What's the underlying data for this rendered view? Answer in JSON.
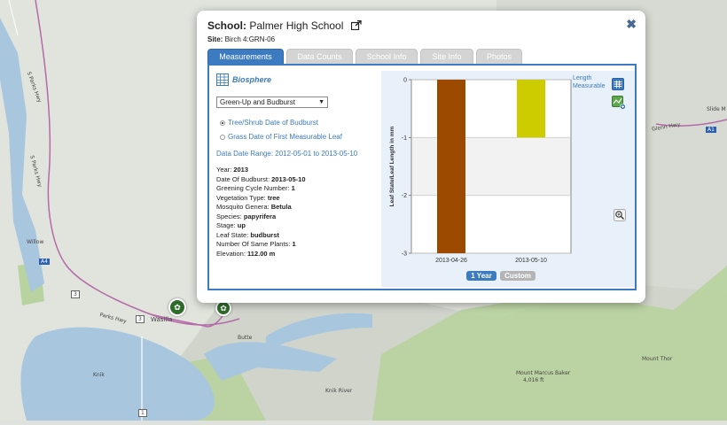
{
  "map": {
    "labels": {
      "parks_hwy_n": "S Parks Hwy",
      "parks_hwy_s": "S Parks Hwy",
      "willow": "Willow",
      "wasilla": "Wasilla",
      "parks_hwy_w": "Parks Hwy",
      "butte": "Butte",
      "knik": "Knik",
      "knik_river": "Knik River",
      "glenn_hwy": "Glenn Hwy",
      "slide_m": "Slide M",
      "mount_marcus_baker": "Mount Marcus Baker",
      "mount_marcus_baker_elev": "4,016 ft",
      "mount_thor": "Mount Thor",
      "shield_3": "3",
      "shield_3b": "3",
      "shield_a4": "A4",
      "shield_a1": "A1",
      "shield_1": "1"
    }
  },
  "popup": {
    "school_label": "School:",
    "school_name": "Palmer High School",
    "site_label": "Site:",
    "site_value": "Birch 4:GRN-06",
    "tabs": [
      {
        "label": "Measurements",
        "active": true
      },
      {
        "label": "Data Counts",
        "active": false
      },
      {
        "label": "School Info",
        "active": false
      },
      {
        "label": "Site Info",
        "active": false
      },
      {
        "label": "Photos",
        "active": false
      }
    ],
    "protocol_group": "Biosphere",
    "protocol_selected": "Green-Up and Budburst",
    "radio_options": [
      {
        "label": "Tree/Shrub Date of Budburst",
        "checked": true
      },
      {
        "label": "Grass Date of First Measurable Leaf",
        "checked": false
      }
    ],
    "date_range_label": "Data Date Range:",
    "date_range_value": "2012-05-01 to 2013-05-10",
    "details": [
      {
        "label": "Year:",
        "value": "2013"
      },
      {
        "label": "Date Of Budburst:",
        "value": "2013-05-10"
      },
      {
        "label": "Greening Cycle Number:",
        "value": "1"
      },
      {
        "label": "Vegetation Type:",
        "value": "tree"
      },
      {
        "label": "Mosquito Genera:",
        "value": "Betula"
      },
      {
        "label": "Species:",
        "value": "papyrifera"
      },
      {
        "label": "Stage:",
        "value": "up"
      },
      {
        "label": "Leaf State:",
        "value": "budburst"
      },
      {
        "label": "Number Of Same Plants:",
        "value": "1"
      },
      {
        "label": "Elevation:",
        "value": "112.00 m"
      }
    ],
    "buttons": {
      "one_year": "1 Year",
      "custom": "Custom"
    },
    "legend": [
      "Length",
      "Measurable"
    ],
    "colors": {
      "accent": "#3c7bc0",
      "bar_1": "#9b4a00",
      "bar_2": "#cccc00"
    }
  },
  "chart_data": {
    "type": "bar",
    "categories": [
      "2013-04-26",
      "2013-05-10"
    ],
    "series": [
      {
        "values": [
          -3,
          -1
        ]
      }
    ],
    "ylabel": "Leaf State/Leaf Length in mm",
    "ylim": [
      -3,
      0
    ],
    "yticks": [
      "0",
      "-1",
      "-2",
      "-3"
    ],
    "grid": true
  }
}
